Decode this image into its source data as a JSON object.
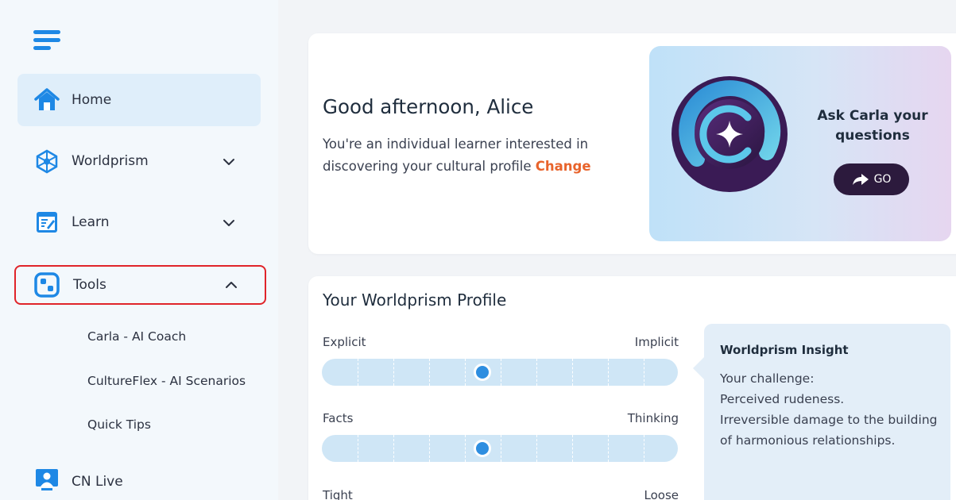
{
  "sidebar": {
    "items": [
      {
        "label": "Home",
        "icon": "home-icon"
      },
      {
        "label": "Worldprism",
        "icon": "worldprism-icon"
      },
      {
        "label": "Learn",
        "icon": "learn-icon"
      },
      {
        "label": "Tools",
        "icon": "tools-icon"
      },
      {
        "label": "CN Live",
        "icon": "cn-live-icon"
      }
    ],
    "tools_sub_items": [
      "Carla - AI Coach",
      "CultureFlex - AI Scenarios",
      "Quick Tips"
    ]
  },
  "greeting": {
    "title": "Good afternoon, Alice",
    "text": "You're an individual learner interested in discovering your cultural profile",
    "change_link": "Change"
  },
  "carla": {
    "title": "Ask Carla your questions",
    "button_label": "GO"
  },
  "profile": {
    "title": "Your Worldprism Profile",
    "dimensions": [
      {
        "left": "Explicit",
        "right": "Implicit",
        "value": 0.45
      },
      {
        "left": "Facts",
        "right": "Thinking",
        "value": 0.45
      },
      {
        "left": "Tight",
        "right": "Loose",
        "value": null
      }
    ],
    "insight": {
      "title": "Worldprism Insight",
      "text_line1": "Your challenge:",
      "text_line2": "Perceived rudeness.",
      "text_line3": "Irreversible damage to the building of harmonious relationships."
    }
  },
  "colors": {
    "accent_blue": "#1e88e5",
    "active_bg": "#dfeefa",
    "highlight_border": "#e0242a",
    "change_link": "#e8642c",
    "go_button": "#2c1a3d"
  }
}
